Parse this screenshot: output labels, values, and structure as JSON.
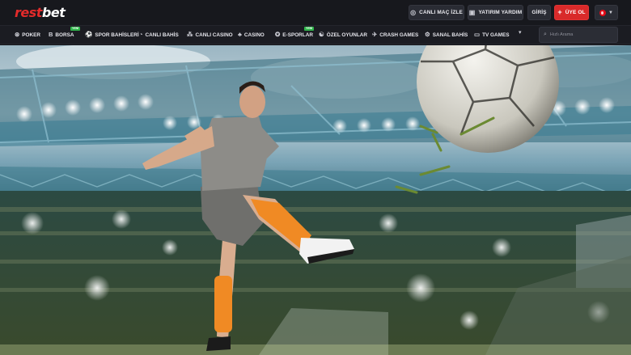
{
  "brand": {
    "logo_part1": "rest",
    "logo_part2": "bet"
  },
  "header": {
    "live_match_label": "CANLI MAÇ İZLE",
    "deposit_help_label": "YATIRIM YARDIM",
    "login_label": "GİRİŞ",
    "register_label": "ÜYE OL",
    "language_flag": "tr-flag"
  },
  "nav": {
    "items": [
      {
        "label": "POKER",
        "icon": "poker-chip-icon"
      },
      {
        "label": "BORSA",
        "icon": "bitcoin-icon",
        "badge": "YENİ"
      },
      {
        "label": "SPOR BAHİSLERİ",
        "icon": "sports-icon"
      },
      {
        "label": "CANLI BAHİS",
        "icon": "live-bet-icon"
      },
      {
        "label": "CANLI CASINO",
        "icon": "cards-icon"
      },
      {
        "label": "CASINO",
        "icon": "slot-icon"
      },
      {
        "label": "E-SPORLAR",
        "icon": "gamepad-icon",
        "badge": "YENİ"
      },
      {
        "label": "ÖZEL OYUNLAR",
        "icon": "special-games-icon"
      },
      {
        "label": "CRASH GAMES",
        "icon": "plane-icon"
      },
      {
        "label": "SANAL BAHİS",
        "icon": "virtual-icon"
      },
      {
        "label": "TV GAMES",
        "icon": "tv-icon"
      }
    ],
    "search_placeholder": "Hızlı Arama"
  },
  "colors": {
    "accent_red": "#d92a2a",
    "badge_green": "#2fb54a",
    "header_bg": "#17181d"
  }
}
